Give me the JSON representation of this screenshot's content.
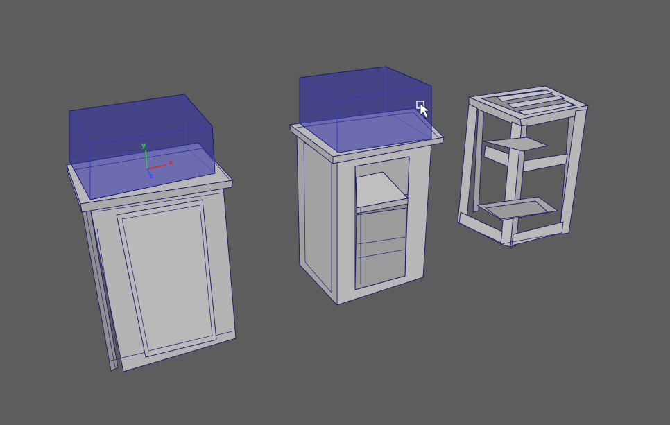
{
  "viewport": {
    "background": "#5d5d5d",
    "mesh_color": "#b6b6b6",
    "mesh_shade": "#9c9c9c",
    "wire_color": "#1f1f66",
    "selection_color": "#2d2da8"
  },
  "gizmo": {
    "y_label": "y",
    "x_label": "x",
    "z_label": "z",
    "y_color": "#33cc33",
    "x_color": "#d62828",
    "z_color": "#3a4cff"
  },
  "cursor": {
    "icon": "select-arrow-icon"
  }
}
